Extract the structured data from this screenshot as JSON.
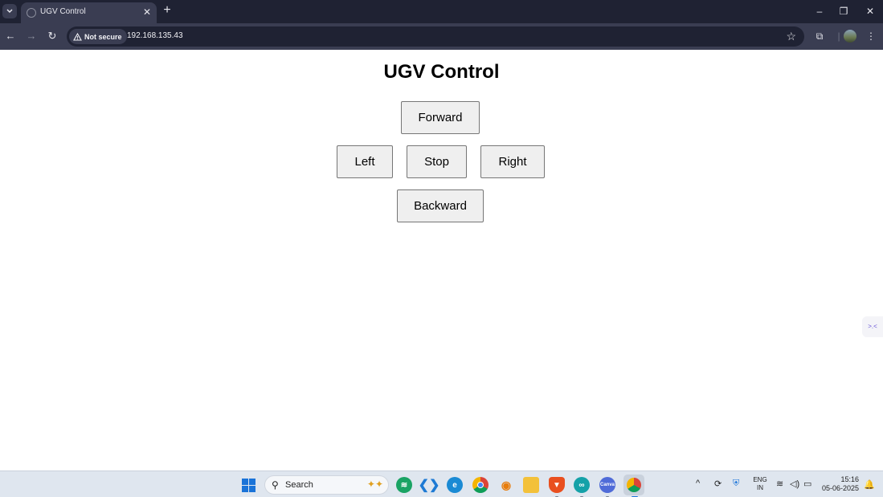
{
  "browser": {
    "tab_title": "UGV Control",
    "new_tab_label": "+",
    "security_label": "Not secure",
    "url": "192.168.135.43"
  },
  "page": {
    "title": "UGV Control",
    "buttons": {
      "forward": "Forward",
      "left": "Left",
      "stop": "Stop",
      "right": "Right",
      "backward": "Backward"
    }
  },
  "taskbar": {
    "search_placeholder": "Search",
    "language_line1": "ENG",
    "language_line2": "IN",
    "time": "15:16",
    "date": "05-06-2025"
  },
  "colors": {
    "tabstrip_bg": "#1f2233",
    "toolbar_bg": "#3a3d52",
    "button_bg": "#efefef",
    "button_border": "#767676",
    "taskbar_bg": "#dfe6ef",
    "windows_blue": "#1a73d8"
  },
  "icons": {
    "tab_menu": "chevron-down-icon",
    "tab_favicon": "globe-icon",
    "tab_close": "close-icon",
    "back": "arrow-left-icon",
    "forward": "arrow-right-icon",
    "reload": "reload-icon",
    "warning": "warning-triangle-icon",
    "bookmark": "star-icon",
    "extensions": "puzzle-icon",
    "menu": "kebab-menu-icon"
  }
}
